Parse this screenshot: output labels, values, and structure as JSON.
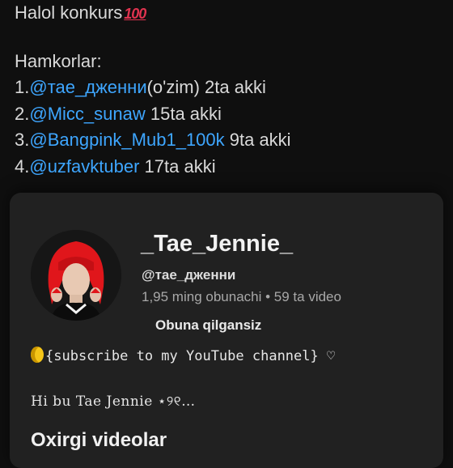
{
  "post": {
    "title": "Halol konkurs",
    "title_emoji": "100",
    "partners_label": "Hamkorlar:",
    "partners": [
      {
        "num": "1.",
        "mention": "@тае_дженни",
        "suffix": "(o'zim) 2ta akki"
      },
      {
        "num": "2.",
        "mention": "@Micc_sunaw",
        "suffix": " 15ta akki"
      },
      {
        "num": "3.",
        "mention": "@Bangpink_Mub1_100k",
        "suffix": " 9ta akki"
      },
      {
        "num": "4.",
        "mention": "@uzfavktuber",
        "suffix": " 17ta akki"
      }
    ]
  },
  "channel": {
    "name": "_Tae_Jennie_",
    "handle": "@тае_дженни",
    "stats": "1,95 ming obunachi • 59 ta video",
    "subscribe_status": "Obuna qilgansiz",
    "description_line1": "{subscribe to my YouTube channel} ♡",
    "description_line2": "Hi bu Tae Jennie ⋆୨୧…",
    "section_title": "Oxirgi videolar",
    "colors": {
      "sheet_bg": "#212121",
      "link": "#3ea6ff",
      "avatar_hair": "#e0161b"
    }
  }
}
